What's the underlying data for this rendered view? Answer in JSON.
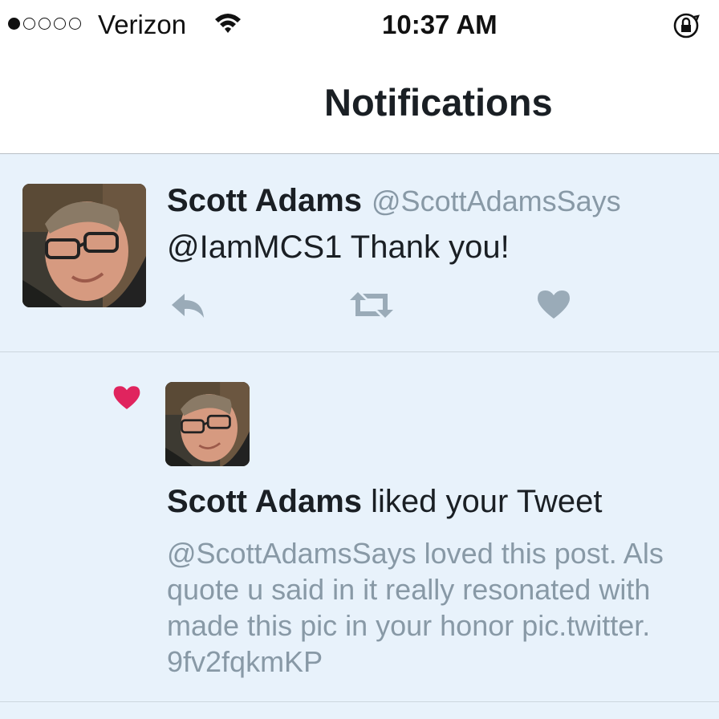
{
  "status_bar": {
    "signal_dots_filled": 1,
    "signal_dots_total": 5,
    "carrier": "Verizon",
    "time": "10:37 AM",
    "icons": [
      "wifi-icon",
      "rotation-lock-icon"
    ]
  },
  "nav": {
    "title": "Notifications"
  },
  "tweet": {
    "display_name": "Scott Adams",
    "handle": "@ScottAdamsSays",
    "text": "@IamMCS1 Thank you!",
    "actions": [
      "reply-icon",
      "retweet-icon",
      "like-icon"
    ]
  },
  "notification": {
    "icon": "heart-icon",
    "actor_name": "Scott Adams",
    "action_text": " liked your Tweet",
    "quoted_lines": [
      "@ScottAdamsSays loved this post. Als",
      "quote u said in it really resonated with",
      "made this pic in your honor pic.twitter.",
      "9fv2fqkmKP"
    ]
  },
  "colors": {
    "feed_background": "#e8f2fb",
    "primary_text": "#1a1f24",
    "secondary_text": "#8899a6",
    "like_heart": "#e0245e",
    "action_icon": "#9aabb8",
    "separator": "#cdd6de"
  }
}
